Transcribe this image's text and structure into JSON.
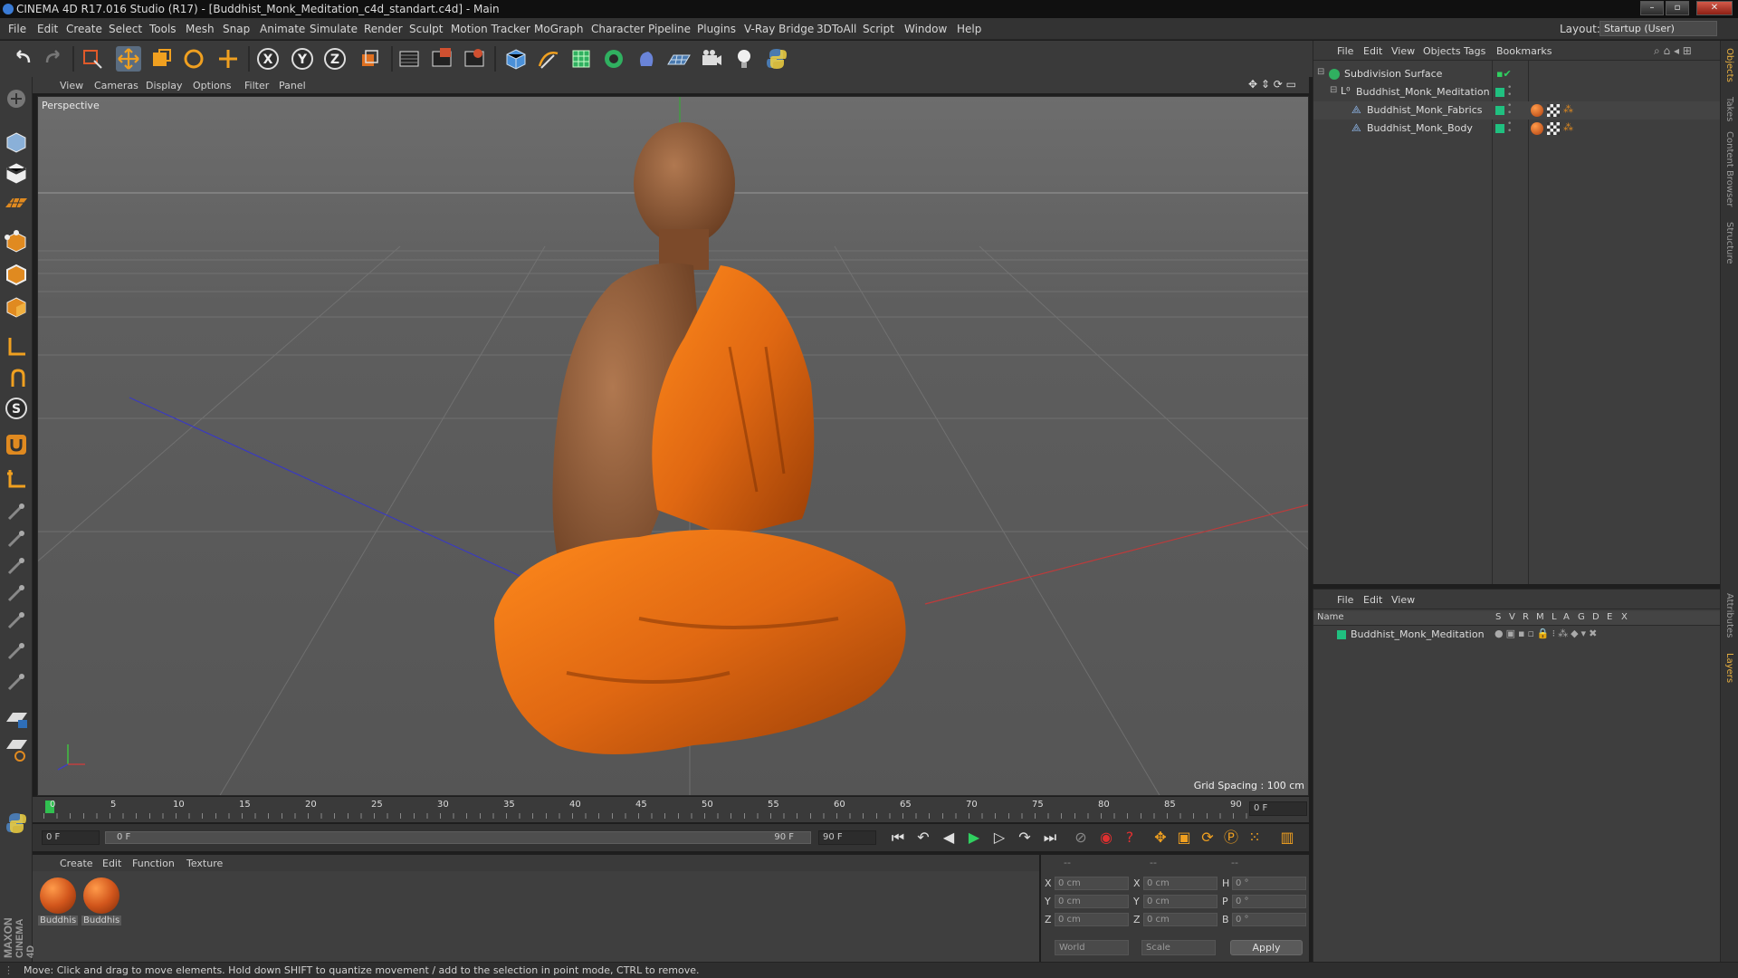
{
  "window": {
    "title": "CINEMA 4D R17.016 Studio (R17) - [Buddhist_Monk_Meditation_c4d_standart.c4d] - Main",
    "buttons": {
      "minimize": "–",
      "maximize": "▫",
      "close": "✕"
    }
  },
  "menubar": {
    "items": [
      "File",
      "Edit",
      "Create",
      "Select",
      "Tools",
      "Mesh",
      "Snap",
      "Animate",
      "Simulate",
      "Render",
      "Sculpt",
      "Motion Tracker",
      "MoGraph",
      "Character",
      "Pipeline",
      "Plugins",
      "V-Ray Bridge",
      "3DToAll",
      "Script",
      "Window",
      "Help"
    ],
    "layout_label": "Layout:",
    "layout_value": "Startup (User)"
  },
  "toolbar": {
    "axis_x": "X",
    "axis_y": "Y",
    "axis_z": "Z"
  },
  "viewport": {
    "menu": [
      "View",
      "Cameras",
      "Display",
      "Options",
      "Filter",
      "Panel"
    ],
    "camera_label": "Perspective",
    "grid_spacing": "Grid Spacing : 100 cm"
  },
  "timeline": {
    "ticks": [
      "0",
      "5",
      "10",
      "15",
      "20",
      "25",
      "30",
      "35",
      "40",
      "45",
      "50",
      "55",
      "60",
      "65",
      "70",
      "75",
      "80",
      "85",
      "90"
    ],
    "current_frame": "0 F",
    "start_field": "0 F",
    "range_start": "0 F",
    "range_end": "90 F",
    "end_field": "90 F"
  },
  "material_manager": {
    "menu": [
      "Create",
      "Edit",
      "Function",
      "Texture"
    ],
    "materials": [
      {
        "label": "Buddhis"
      },
      {
        "label": "Buddhis"
      }
    ]
  },
  "coordinates": {
    "header": [
      "--",
      "--",
      "--"
    ],
    "rows": [
      {
        "axis": "X",
        "pos": "0 cm",
        "axis2": "X",
        "size": "0 cm",
        "rot_label": "H",
        "rot": "0 °"
      },
      {
        "axis": "Y",
        "pos": "0 cm",
        "axis2": "Y",
        "size": "0 cm",
        "rot_label": "P",
        "rot": "0 °"
      },
      {
        "axis": "Z",
        "pos": "0 cm",
        "axis2": "Z",
        "size": "0 cm",
        "rot_label": "B",
        "rot": "0 °"
      }
    ],
    "mode_select": "World",
    "scale_select": "Scale",
    "apply_label": "Apply"
  },
  "object_manager": {
    "menu": [
      "File",
      "Edit",
      "View",
      "Objects",
      "Tags",
      "Bookmarks"
    ],
    "objects": [
      {
        "name": "Subdivision Surface",
        "indent": 0
      },
      {
        "name": "Buddhist_Monk_Meditation",
        "indent": 1
      },
      {
        "name": "Buddhist_Monk_Fabrics",
        "indent": 2
      },
      {
        "name": "Buddhist_Monk_Body",
        "indent": 2
      }
    ]
  },
  "layer_manager": {
    "menu": [
      "File",
      "Edit",
      "View"
    ],
    "columns": [
      "Name",
      "S",
      "V",
      "R",
      "M",
      "L",
      "A",
      "G",
      "D",
      "E",
      "X"
    ],
    "layers": [
      {
        "name": "Buddhist_Monk_Meditation"
      }
    ]
  },
  "right_tabs": [
    "Objects",
    "Takes",
    "Content Browser",
    "Structure",
    "Attributes",
    "Layers"
  ],
  "status": {
    "text": "Move: Click and drag to move elements. Hold down SHIFT to quantize movement / add to the selection in point mode, CTRL to remove."
  },
  "logo": {
    "line1": "MAXON",
    "line2": "CINEMA 4D"
  },
  "colors": {
    "accent_blue": "#3a7bd5",
    "robe_orange": "#e06a14",
    "layer_green": "#20c080",
    "active_tab": "#e8b040"
  }
}
